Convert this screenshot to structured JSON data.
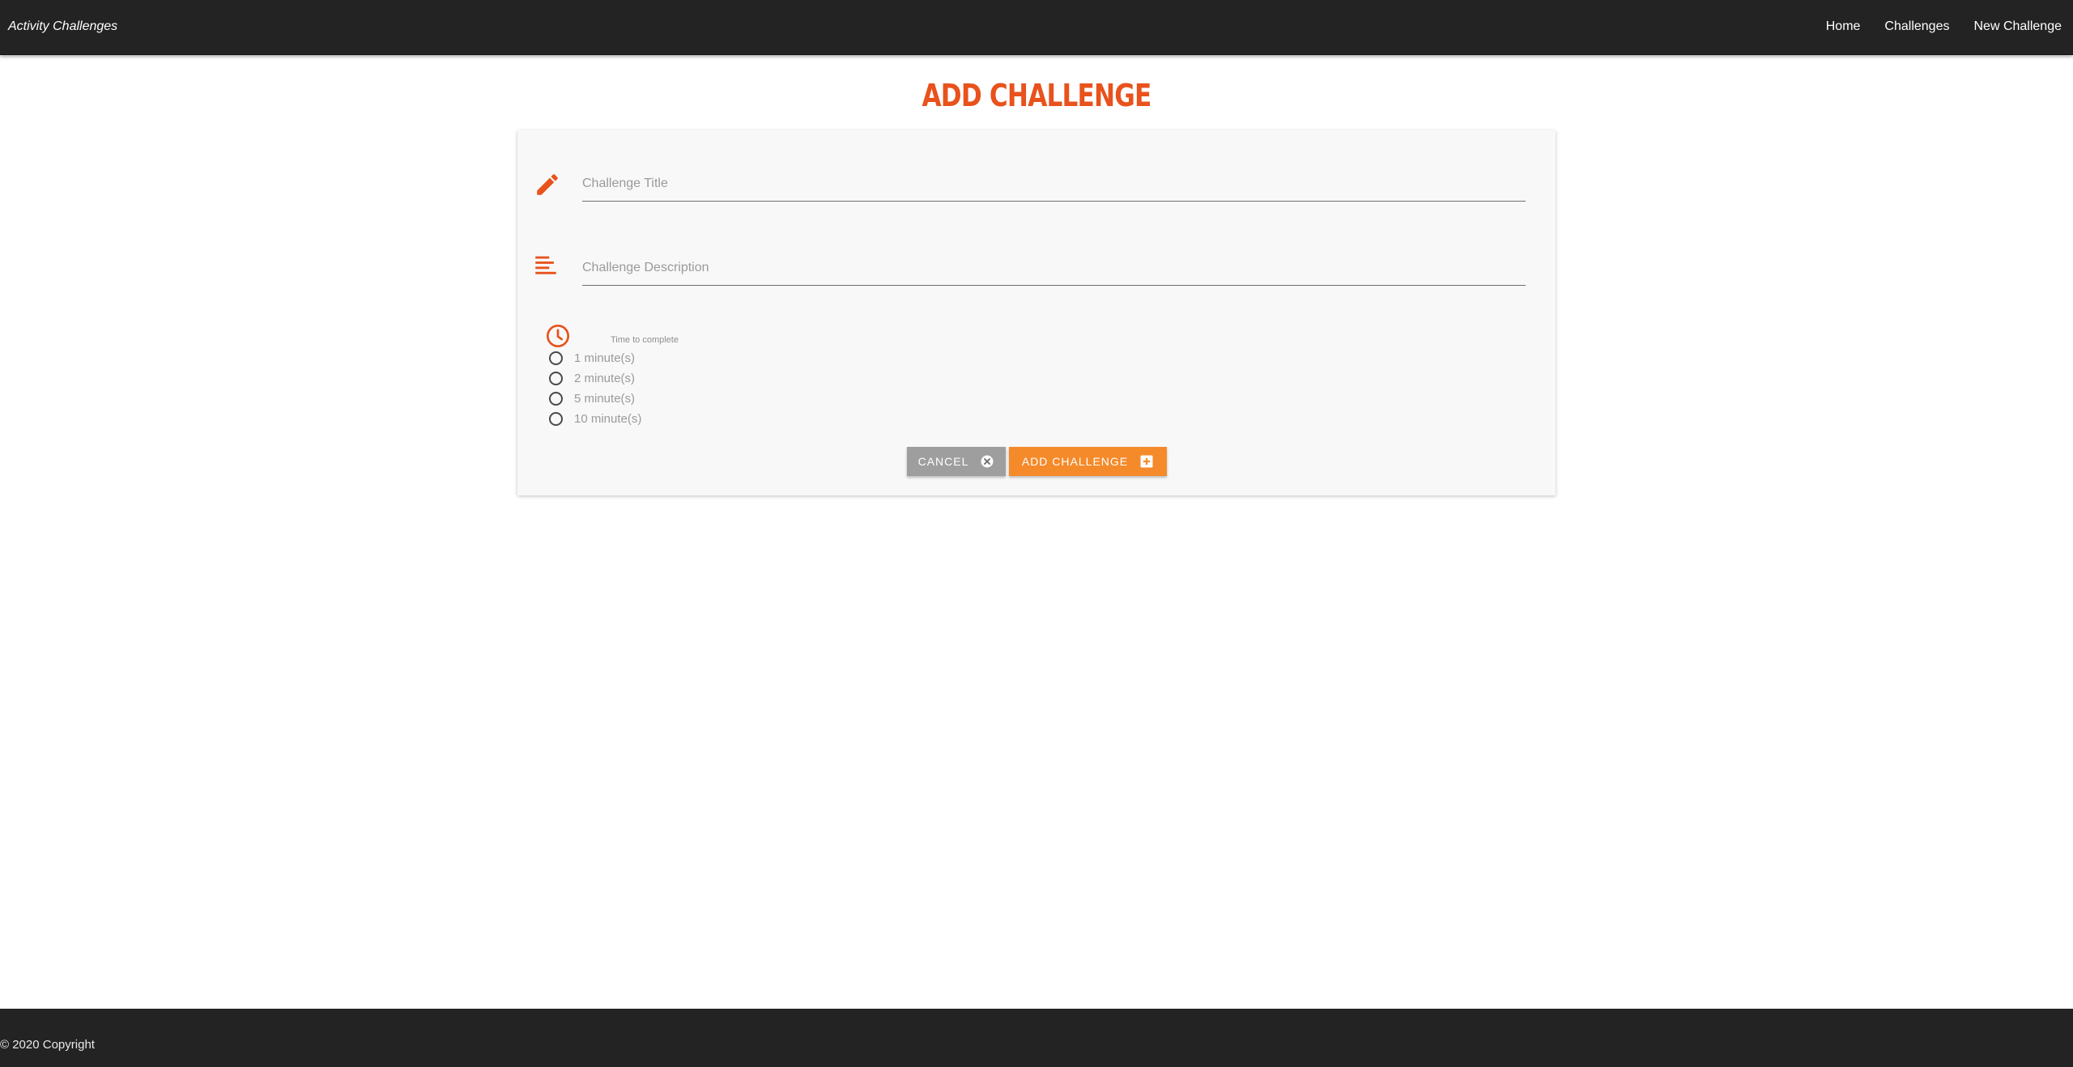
{
  "navbar": {
    "brand": "Activity Challenges",
    "links": [
      "Home",
      "Challenges",
      "New Challenge"
    ]
  },
  "page": {
    "title": "ADD CHALLENGE"
  },
  "form": {
    "title_placeholder": "Challenge Title",
    "title_value": "",
    "description_placeholder": "Challenge Description",
    "description_value": "",
    "time_label": "Time to complete",
    "time_options": [
      "1 minute(s)",
      "2 minute(s)",
      "5 minute(s)",
      "10 minute(s)"
    ],
    "selected_time": null,
    "cancel_label": "CANCEL",
    "submit_label": "ADD CHALLENGE"
  },
  "footer": {
    "copyright": "© 2020 Copyright"
  },
  "colors": {
    "accent": "#e8521c",
    "submit_button": "#f58a2a",
    "cancel_button": "#9e9e9e",
    "navbar": "#232323"
  },
  "icons": {
    "title_field": "pencil-icon",
    "description_field": "align-left-icon",
    "time_field": "clock-icon",
    "cancel_button": "close-circle-icon",
    "submit_button": "plus-box-icon"
  }
}
